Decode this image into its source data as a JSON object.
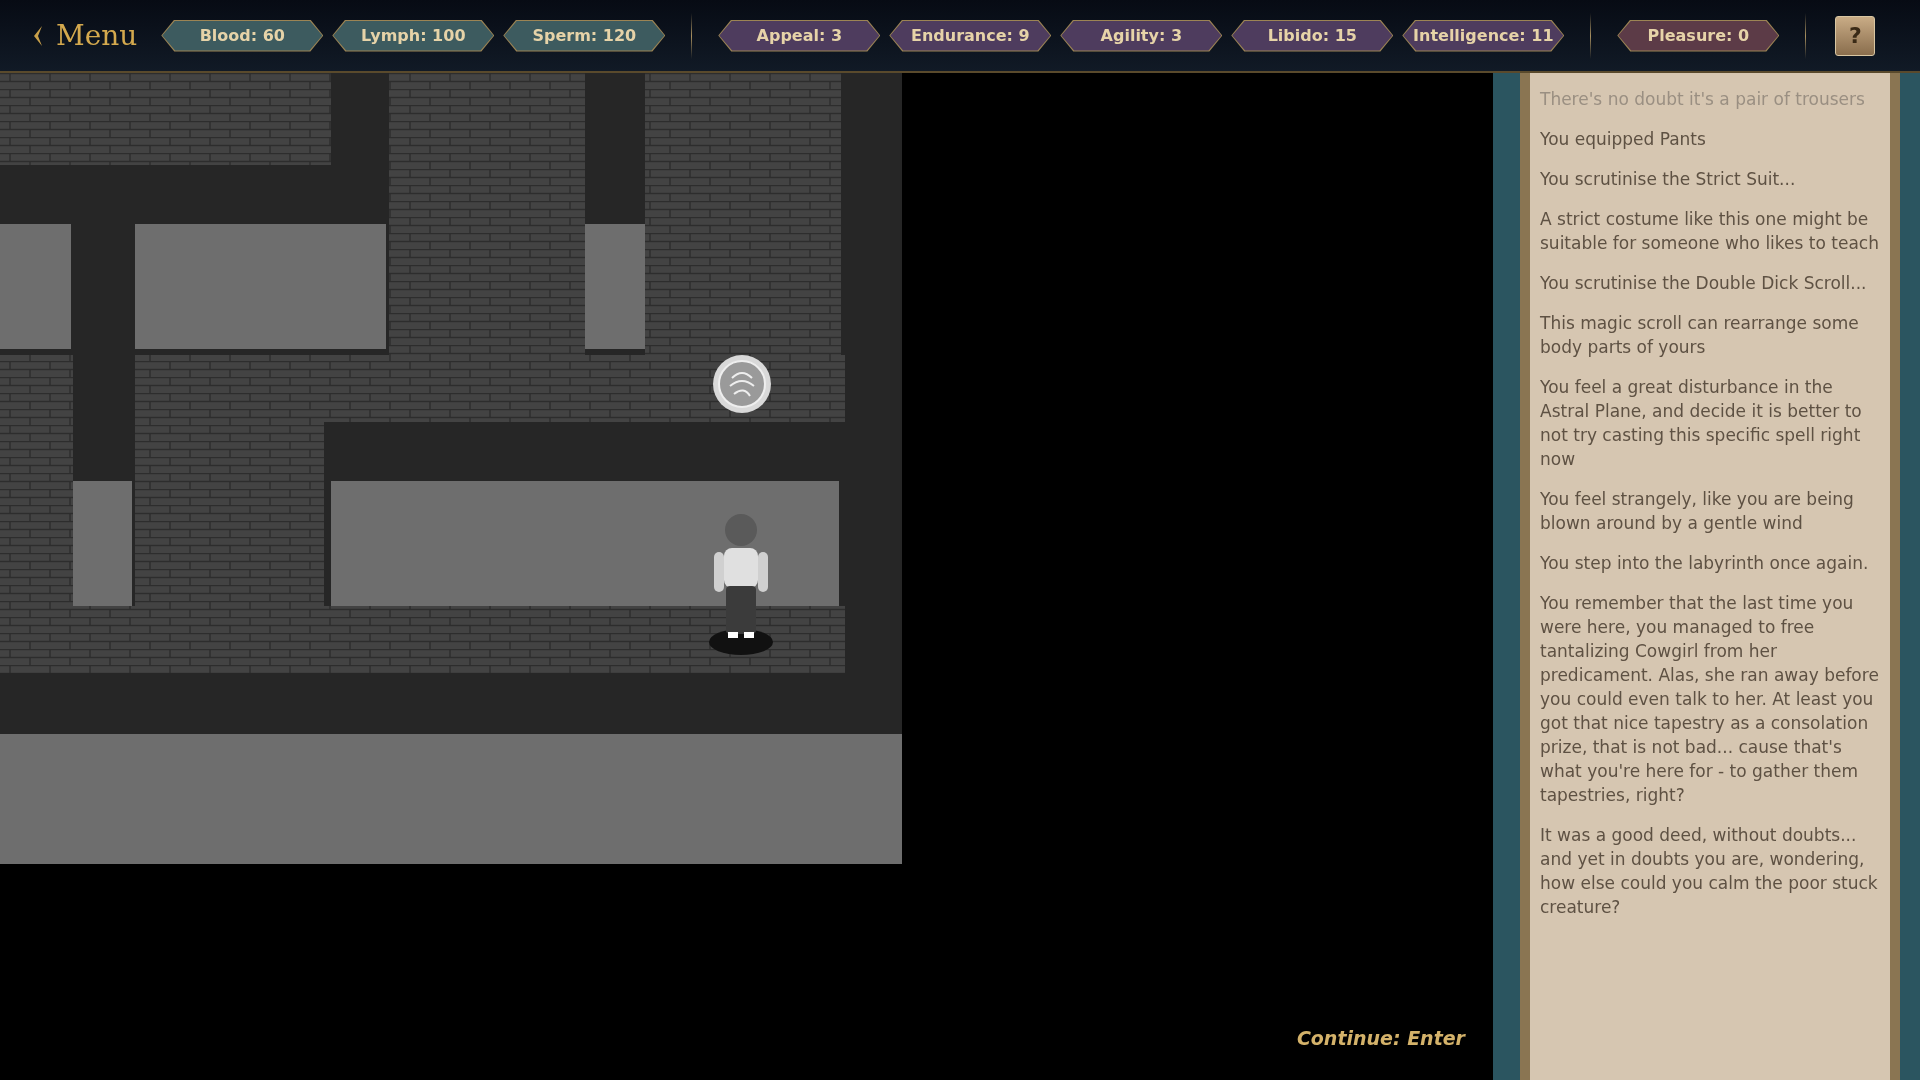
{
  "menu": {
    "label": "Menu"
  },
  "stat_groups": [
    {
      "stats": [
        {
          "label": "Blood: 60",
          "color": "#3d5b5f"
        },
        {
          "label": "Lymph: 100",
          "color": "#3d5b5f"
        },
        {
          "label": "Sperm: 120",
          "color": "#3d5b5f"
        }
      ]
    },
    {
      "stats": [
        {
          "label": "Appeal: 3",
          "color": "#4e3c5e"
        },
        {
          "label": "Endurance: 9",
          "color": "#4e3c5e"
        },
        {
          "label": "Agility: 3",
          "color": "#4e3c5e"
        },
        {
          "label": "Libido: 15",
          "color": "#4e3c5e"
        },
        {
          "label": "Intelligence: 11",
          "color": "#4e3c5e"
        }
      ]
    },
    {
      "stats": [
        {
          "label": "Pleasure: 0",
          "color": "#5c3b47"
        }
      ]
    }
  ],
  "help_button": {
    "label": "?"
  },
  "continue_hint": "Continue: Enter",
  "log": [
    {
      "text": "There's no doubt it's a pair of trousers",
      "faded": true
    },
    {
      "text": "You equipped Pants",
      "faded": false
    },
    {
      "text": "You scrutinise the Strict Suit...",
      "faded": false
    },
    {
      "text": "A strict costume like this one might be suitable for someone who likes to teach",
      "faded": false
    },
    {
      "text": "You scrutinise the Double Dick Scroll...",
      "faded": false
    },
    {
      "text": "This magic scroll can rearrange some body parts of yours",
      "faded": false
    },
    {
      "text": "You feel a great disturbance in the Astral Plane, and decide it is better to not try casting this specific spell right now",
      "faded": false
    },
    {
      "text": "You feel strangely, like you are being blown around by a gentle wind",
      "faded": false
    },
    {
      "text": "You step into the labyrinth once again.",
      "faded": false
    },
    {
      "text": "You remember that the last time you were here, you managed to free tantalizing Cowgirl from her predicament. Alas, she ran away before you could even talk to her. At least you got that nice tapestry as a consolation prize, that is not bad... cause that's what you're here for - to gather them tapestries, right?",
      "faded": false
    },
    {
      "text": "It was a good deed, without doubts... and yet in doubts you are, wondering, how else could you calm the poor stuck creature?",
      "faded": false
    }
  ]
}
